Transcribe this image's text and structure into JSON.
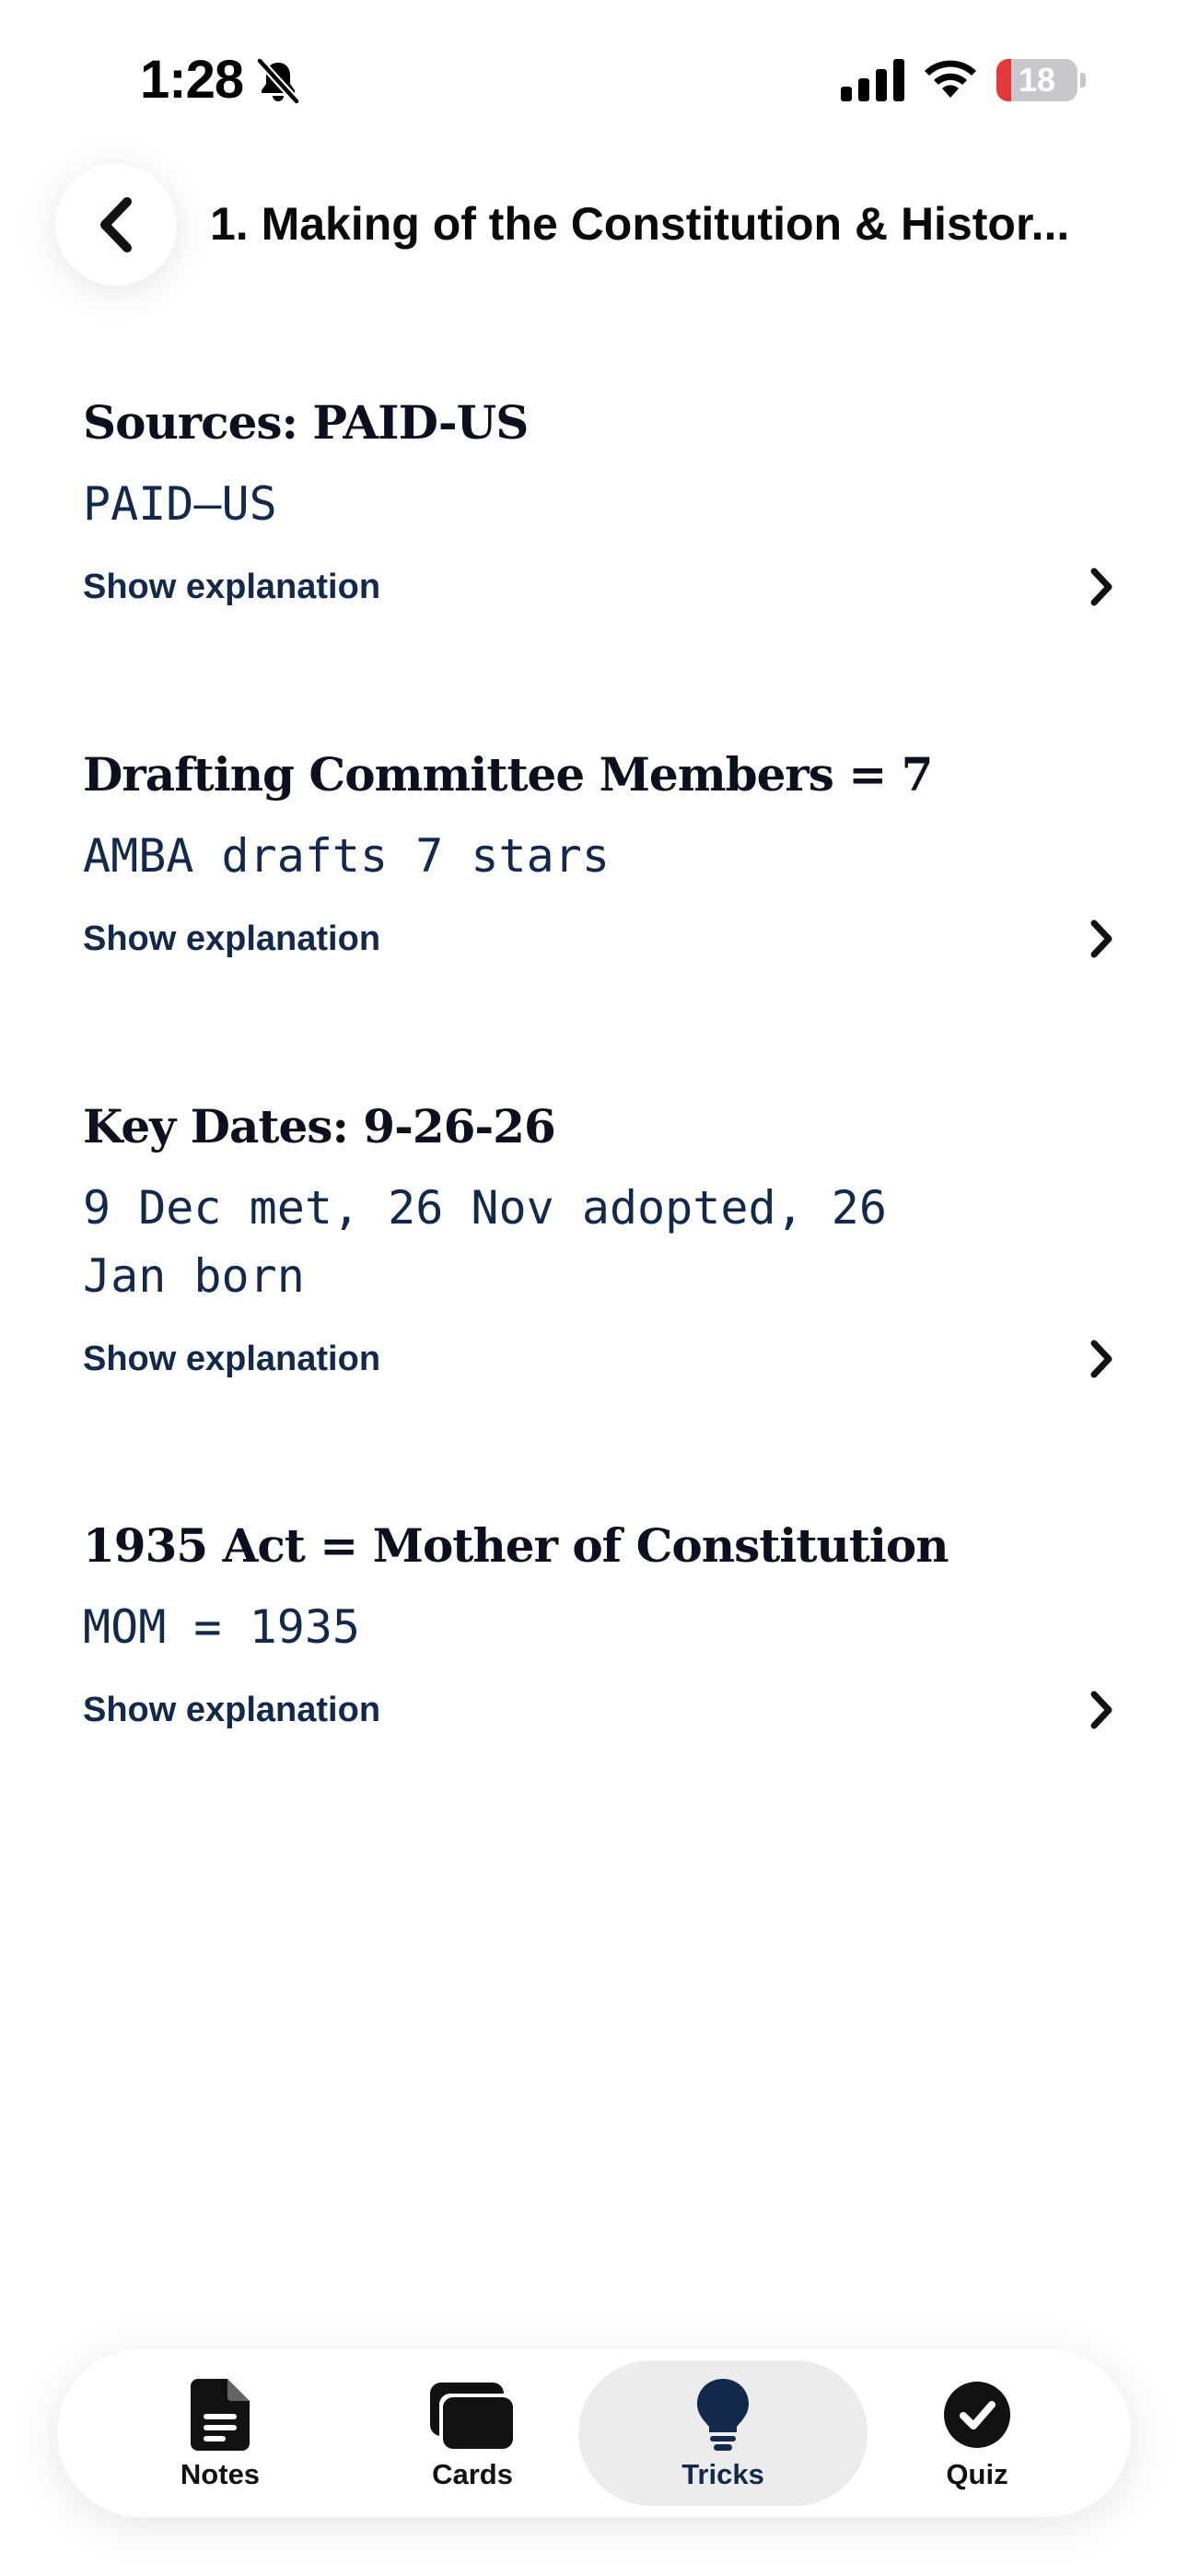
{
  "status_bar": {
    "time": "1:28",
    "battery_level": "18",
    "battery_fraction": 0.18,
    "icons": [
      "bell-slash-icon",
      "cellular-signal-icon",
      "wifi-icon",
      "battery-icon"
    ]
  },
  "header": {
    "back_icon": "chevron-left-icon",
    "title": "1. Making of the Constitution & Histor..."
  },
  "tricks": [
    {
      "title": "Sources: PAID-US",
      "mnemonic": "PAID–US",
      "explanation_label": "Show explanation"
    },
    {
      "title": "Drafting Committee Members = 7",
      "mnemonic": "AMBA drafts 7 stars",
      "explanation_label": "Show explanation"
    },
    {
      "title": "Key Dates: 9-26-26",
      "mnemonic": "9 Dec met, 26 Nov adopted, 26 Jan born",
      "explanation_label": "Show explanation"
    },
    {
      "title": "1935 Act = Mother of Constitution",
      "mnemonic": "MOM = 1935",
      "explanation_label": "Show explanation"
    }
  ],
  "tab_bar": {
    "active": "Tricks",
    "tabs": [
      {
        "label": "Notes",
        "icon": "document-icon"
      },
      {
        "label": "Cards",
        "icon": "cards-icon"
      },
      {
        "label": "Tricks",
        "icon": "lightbulb-icon"
      },
      {
        "label": "Quiz",
        "icon": "checkmark-circle-icon"
      }
    ]
  },
  "colors": {
    "accent_navy": "#13294b",
    "title_text": "#0b0f1e",
    "active_tab_bg": "#ececec",
    "battery_low": "#e5383b"
  }
}
